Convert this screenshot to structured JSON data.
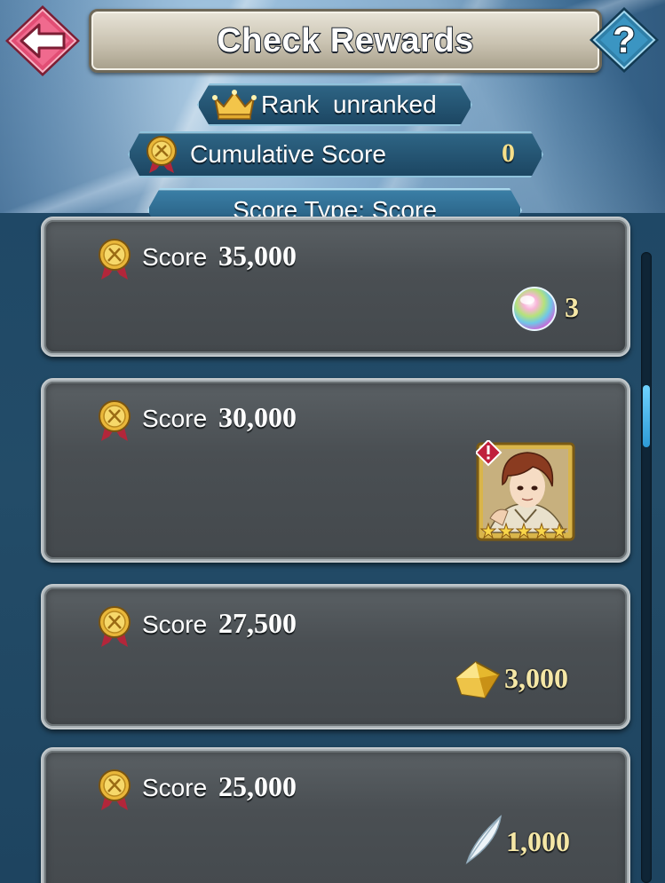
{
  "header": {
    "title": "Check Rewards",
    "back_icon": "back-arrow-icon",
    "help_icon": "help-icon",
    "help_label": "?"
  },
  "rank": {
    "label": "Rank",
    "value": "unranked",
    "icon": "crown-icon"
  },
  "cumulative": {
    "label": "Cumulative Score",
    "value": "0",
    "icon": "medal-icon"
  },
  "score_type": {
    "label": "Score Type: Score"
  },
  "rewards": [
    {
      "label": "Score",
      "value": "35,000",
      "reward_icon": "orb-icon",
      "reward_qty": "3"
    },
    {
      "label": "Score",
      "value": "30,000",
      "reward_icon": "hero-portrait-icon",
      "reward_qty": ""
    },
    {
      "label": "Score",
      "value": "27,500",
      "reward_icon": "crystal-icon",
      "reward_qty": "3,000"
    },
    {
      "label": "Score",
      "value": "25,000",
      "reward_icon": "feather-icon",
      "reward_qty": "1,000"
    }
  ],
  "colors": {
    "accent_gold": "#f5e7a6",
    "pill_blue": "#2e6585",
    "back_button": "#e0436b",
    "help_button": "#2f7fa8"
  }
}
